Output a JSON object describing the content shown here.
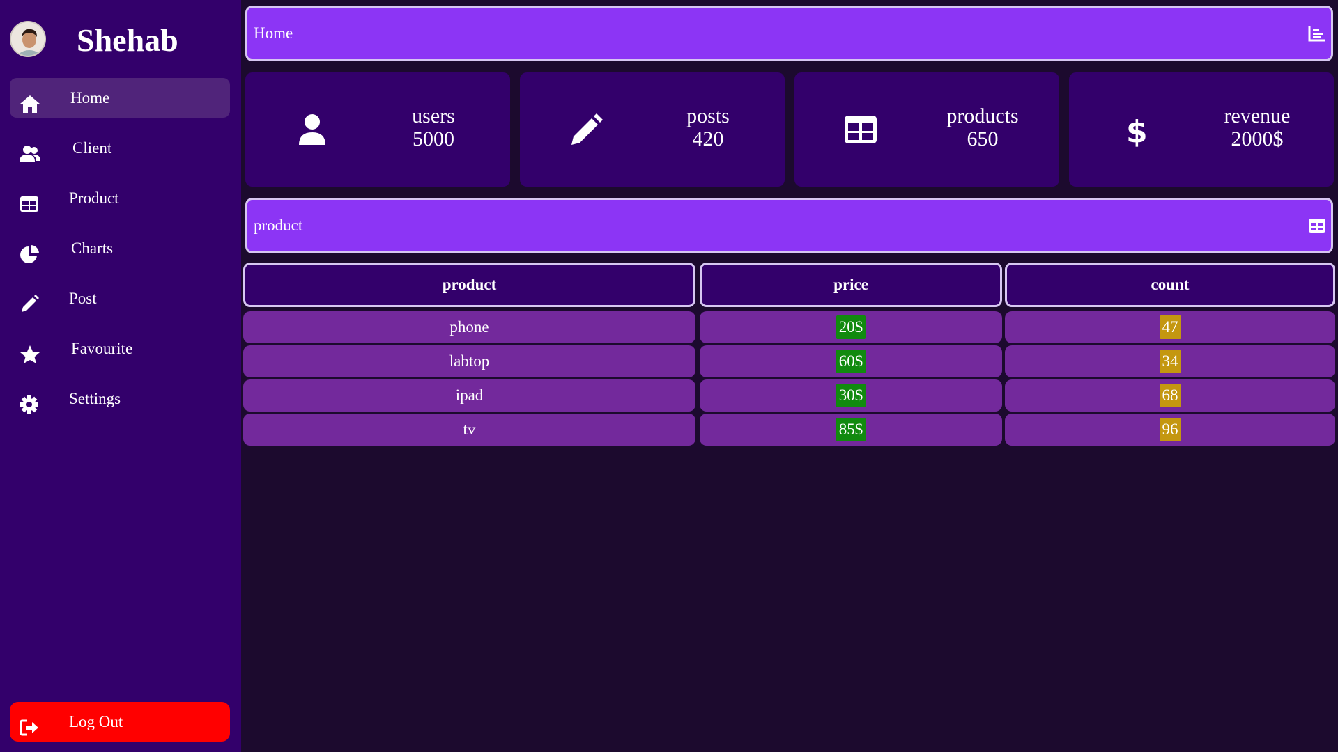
{
  "brand": {
    "name": "Shehab"
  },
  "sidebar": {
    "items": [
      {
        "label": "Home",
        "icon": "home-icon",
        "active": true
      },
      {
        "label": "Client",
        "icon": "users-icon",
        "active": false
      },
      {
        "label": "Product",
        "icon": "table-icon",
        "active": false
      },
      {
        "label": "Charts",
        "icon": "pie-chart-icon",
        "active": false
      },
      {
        "label": "Post",
        "icon": "pencil-icon",
        "active": false
      },
      {
        "label": "Favourite",
        "icon": "star-icon",
        "active": false
      },
      {
        "label": "Settings",
        "icon": "gear-icon",
        "active": false
      }
    ],
    "logout": {
      "label": "Log Out",
      "icon": "logout-icon"
    }
  },
  "home_header": {
    "title": "Home",
    "icon": "chart-bar-icon"
  },
  "stats": [
    {
      "label": "users",
      "value": "5000",
      "icon": "user-icon"
    },
    {
      "label": "posts",
      "value": "420",
      "icon": "pencil-icon"
    },
    {
      "label": "products",
      "value": "650",
      "icon": "table-icon"
    },
    {
      "label": "revenue",
      "value": "2000$",
      "icon": "dollar-icon"
    }
  ],
  "product_header": {
    "title": "product",
    "icon": "table-icon"
  },
  "product_table": {
    "headers": [
      "product",
      "price",
      "count"
    ],
    "rows": [
      {
        "product": "phone",
        "price": "20$",
        "count": "47"
      },
      {
        "product": "labtop",
        "price": "60$",
        "count": "34"
      },
      {
        "product": "ipad",
        "price": "30$",
        "count": "68"
      },
      {
        "product": "tv",
        "price": "85$",
        "count": "96"
      }
    ]
  },
  "colors": {
    "sidebar_bg": "#33006b",
    "page_bg": "#1c0a2e",
    "header_bg": "#8c35f5",
    "active_item": "#50247a",
    "logout": "#ff0000",
    "row_bg": "#73299c",
    "price_badge": "#118a0f",
    "count_badge": "#c49710"
  }
}
